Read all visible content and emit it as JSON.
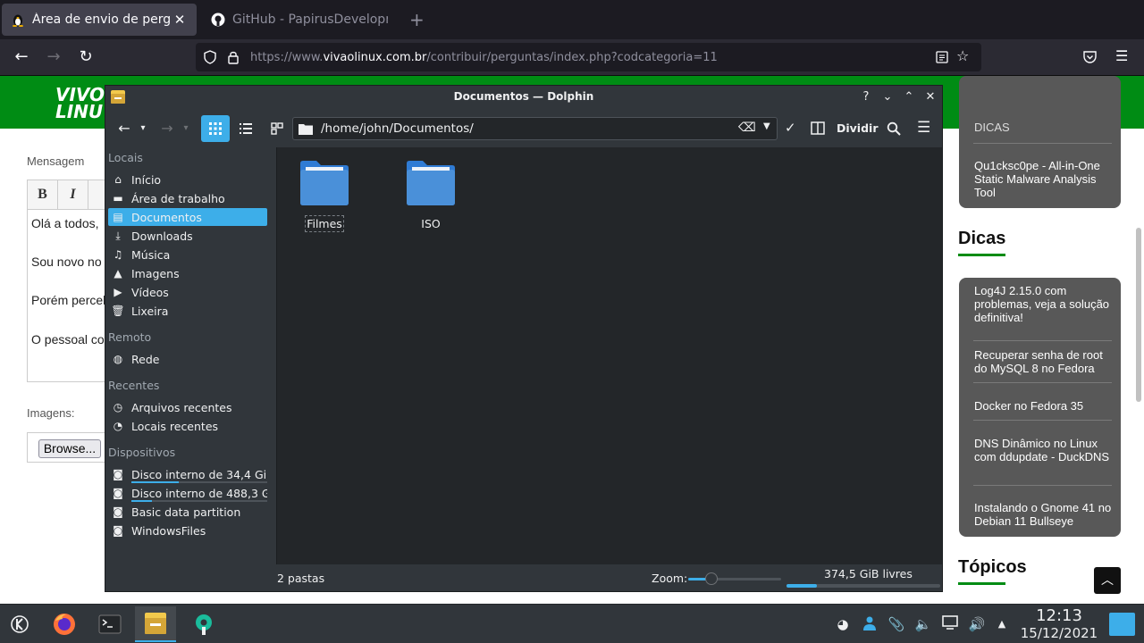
{
  "browser": {
    "tabs": [
      {
        "title": "Área de envio de perguntas",
        "active": true
      },
      {
        "title": "GitHub - PapirusDevelopme",
        "active": false
      }
    ],
    "url_prefix": "https://www.",
    "url_domain": "vivaolinux.com.br",
    "url_path": "/contribuir/perguntas/index.php?codcategoria=11"
  },
  "page": {
    "logo_line1": "VIVO",
    "logo_line2": "LINU",
    "mensagem_label": "Mensagem",
    "editor_bold": "B",
    "editor_italic": "I",
    "editor_lines": [
      "Olá a todos,",
      "Sou novo no Linux, e usei cinnamon e",
      "Porém percebi que alguns temas, quando ap",
      "O pessoal com mais experiência no KDE, co"
    ],
    "imagens_label": "Imagens:",
    "browse_label": "Browse...",
    "sidebar": {
      "top_item_partial": "DICAS",
      "top_item": "Qu1cksc0pe - All-in-One Static Malware Analysis Tool",
      "dicas_heading": "Dicas",
      "dicas": [
        "Log4J 2.15.0 com problemas, veja a solução definitiva!",
        "Recuperar senha de root do MySQL 8 no Fedora",
        "Docker no Fedora 35",
        "DNS Dinâmico no Linux com ddupdate - DuckDNS",
        "Instalando o Gnome 41 no Debian 11 Bullseye"
      ],
      "topicos_heading": "Tópicos"
    }
  },
  "dolphin": {
    "title": "Documentos — Dolphin",
    "path": "/home/john/Documentos/",
    "split_label": "Dividir",
    "places": {
      "locais_heading": "Locais",
      "locais": [
        {
          "label": "Início",
          "icon": "home-icon"
        },
        {
          "label": "Área de trabalho",
          "icon": "desktop-icon"
        },
        {
          "label": "Documentos",
          "icon": "document-icon",
          "selected": true
        },
        {
          "label": "Downloads",
          "icon": "download-icon"
        },
        {
          "label": "Música",
          "icon": "music-icon"
        },
        {
          "label": "Imagens",
          "icon": "image-icon"
        },
        {
          "label": "Vídeos",
          "icon": "video-icon"
        },
        {
          "label": "Lixeira",
          "icon": "trash-icon"
        }
      ],
      "remoto_heading": "Remoto",
      "remoto": [
        {
          "label": "Rede",
          "icon": "network-icon"
        }
      ],
      "recentes_heading": "Recentes",
      "recentes": [
        {
          "label": "Arquivos recentes",
          "icon": "clock-icon"
        },
        {
          "label": "Locais recentes",
          "icon": "recent-places-icon"
        }
      ],
      "dispositivos_heading": "Dispositivos",
      "dispositivos": [
        {
          "label": "Disco interno de 34,4 Gi...",
          "icon": "drive-icon",
          "usage": 0.35
        },
        {
          "label": "Disco interno de 488,3 G...",
          "icon": "drive-icon",
          "usage": 0.15
        },
        {
          "label": "Basic data partition",
          "icon": "drive-unmounted-icon"
        },
        {
          "label": "WindowsFiles",
          "icon": "drive-unmounted-icon"
        }
      ]
    },
    "folders": [
      "Filmes",
      "ISO"
    ],
    "status_text": "2 pastas",
    "zoom_label": "Zoom:",
    "zoom_level": 0.25,
    "free_space": "374,5 GiB livres",
    "used_fraction": 0.2
  },
  "panel": {
    "time": "12:13",
    "date": "15/12/2021"
  },
  "colors": {
    "accent": "#3daee9",
    "site_green": "#008c14",
    "folder_blue": "#4a90d9"
  }
}
